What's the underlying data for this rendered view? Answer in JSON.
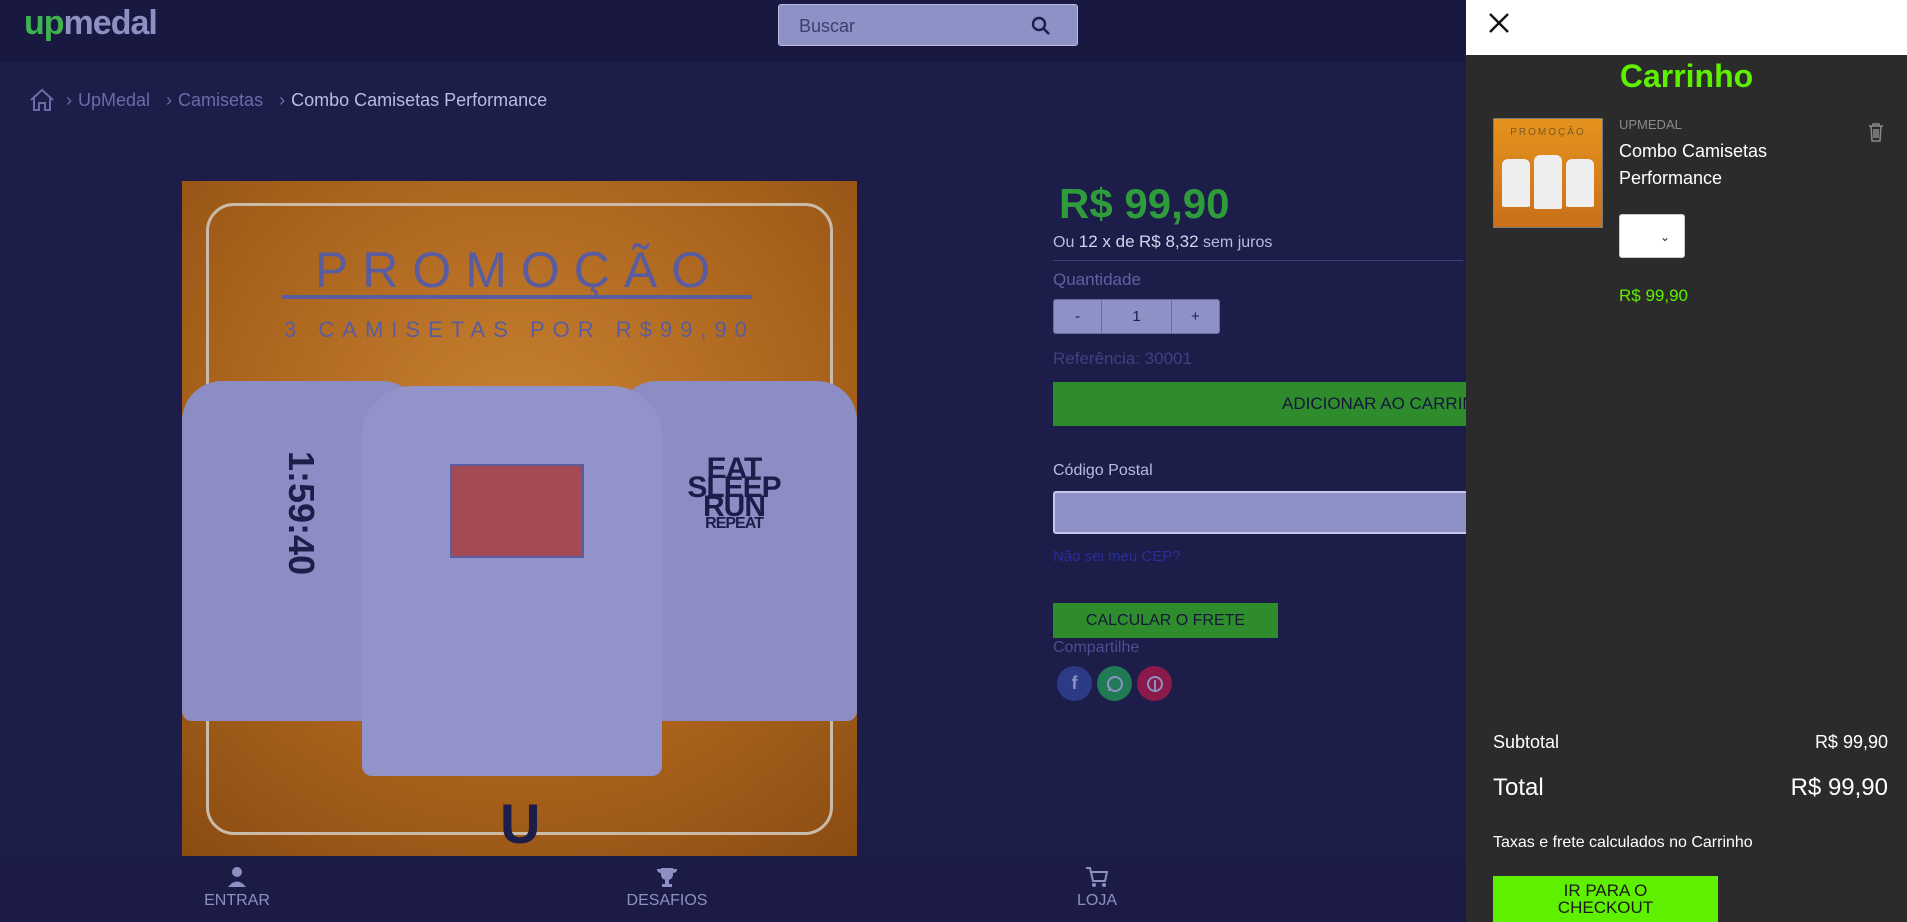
{
  "header": {
    "logo_text_u": "up",
    "logo_text_rest": "medal",
    "search_placeholder": "Buscar",
    "search_icon": "search-icon"
  },
  "breadcrumb": {
    "home_icon": "home-icon",
    "items": [
      "UpMedal",
      "Camisetas",
      "Combo Camisetas Performance"
    ]
  },
  "product_image": {
    "title": "PROMOÇÃO",
    "subtitle": "3 CAMISETAS POR R$99,90",
    "shirt_left_text": "1:59:40",
    "shirt_right_line1": "EAT",
    "shirt_right_line2": "SLEEP",
    "shirt_right_line3": "RUN",
    "shirt_right_line4": "REPEAT",
    "logo_glyph": "U"
  },
  "product": {
    "price": "R$ 99,90",
    "installment_prefix": "Ou",
    "installment_count": "12 x de",
    "installment_value": "R$ 8,32",
    "installment_suffix": "sem juros",
    "quantity_label": "Quantidade",
    "quantity_minus": "-",
    "quantity_value": "1",
    "quantity_plus": "+",
    "reference": "Referência: 30001",
    "add_to_cart": "ADICIONAR AO CARRINHO",
    "postal_label": "Código Postal",
    "postal_value": "",
    "postal_link": "Não sei meu CEP?",
    "calc_shipping": "CALCULAR O FRETE",
    "share_label": "Compartilhe",
    "share": [
      "f",
      "w",
      "p"
    ]
  },
  "bottom_nav": [
    {
      "label": "ENTRAR",
      "icon": "user-icon"
    },
    {
      "label": "DESAFIOS",
      "icon": "trophy-icon"
    },
    {
      "label": "LOJA",
      "icon": "cart-icon"
    }
  ],
  "cart": {
    "title": "Carrinho",
    "item": {
      "brand": "UPMEDAL",
      "name": "Combo Camisetas Performance",
      "price": "R$ 99,90",
      "thumb_text": "PROMOÇÃO"
    },
    "subtotal_label": "Subtotal",
    "subtotal_value": "R$ 99,90",
    "total_label": "Total",
    "total_value": "R$ 99,90",
    "tax_note": "Taxas e frete calculados no Carrinho",
    "checkout": "IR PARA O CHECKOUT"
  },
  "colors": {
    "background": "#1d1d49",
    "accent_green": "#2f8c2d",
    "cart_green": "#5ff000",
    "drawer_bg": "#2b2b2b"
  }
}
